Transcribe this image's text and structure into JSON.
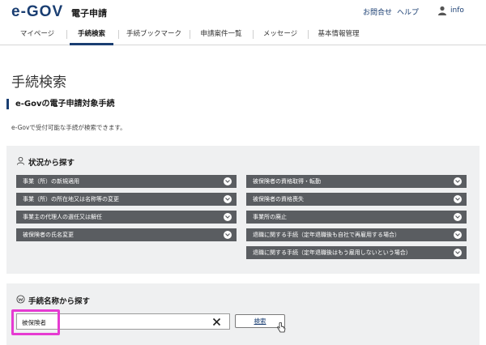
{
  "header": {
    "logo_text": "e-GOV",
    "logo_sub": "電子申請",
    "links": {
      "inquiry": "お問合せ",
      "help": "ヘルプ"
    },
    "user_label": "info"
  },
  "nav": {
    "items": [
      "マイページ",
      "手続検索",
      "手続ブックマーク",
      "申請案件一覧",
      "メッセージ",
      "基本情報管理"
    ],
    "active": "手続検索"
  },
  "page": {
    "title": "手続検索",
    "section_heading": "e-Govの電子申請対象手続",
    "section_desc": "e-Govで受付可能な手続が検索できます。"
  },
  "status_search": {
    "title": "状況から探す",
    "left": [
      "事業（所）の新規適用",
      "事業（所）の所在地又は名称等の変更",
      "事業主の代理人の選任又は解任",
      "被保険者の氏名変更"
    ],
    "right": [
      "被保険者の資格取得・転勤",
      "被保険者の資格喪失",
      "事業所の廃止",
      "退職に関する手続（定年退職後も自社で再雇用する場合）",
      "退職に関する手続（定年退職後はもう雇用しないという場合）"
    ]
  },
  "name_search": {
    "title": "手続名称から探す",
    "input_value": "被保険者",
    "button_label": "検索"
  },
  "colors": {
    "brand": "#1a3e72",
    "dropdown_bg": "#5a5d61",
    "panel_bg": "#eff0f1",
    "highlight": "#e63bd2"
  }
}
